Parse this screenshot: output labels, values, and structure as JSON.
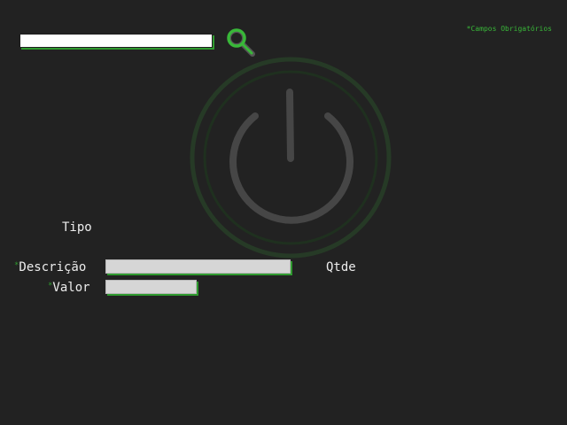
{
  "search": {
    "value": "",
    "placeholder": ""
  },
  "required_note": "*Campos Obrigatórios",
  "form": {
    "tipo_label": "Tipo",
    "descricao_label": "Descrição",
    "descricao_marker": "*",
    "descricao_value": "",
    "valor_label": "Valor",
    "valor_marker": "*",
    "valor_value": "",
    "qtde_label": "Qtde"
  },
  "icons": {
    "search": "magnifier-icon",
    "background": "power-icon"
  },
  "colors": {
    "background": "#222222",
    "accent": "#39b739",
    "text": "#ececec",
    "field": "#d6d6d6"
  }
}
